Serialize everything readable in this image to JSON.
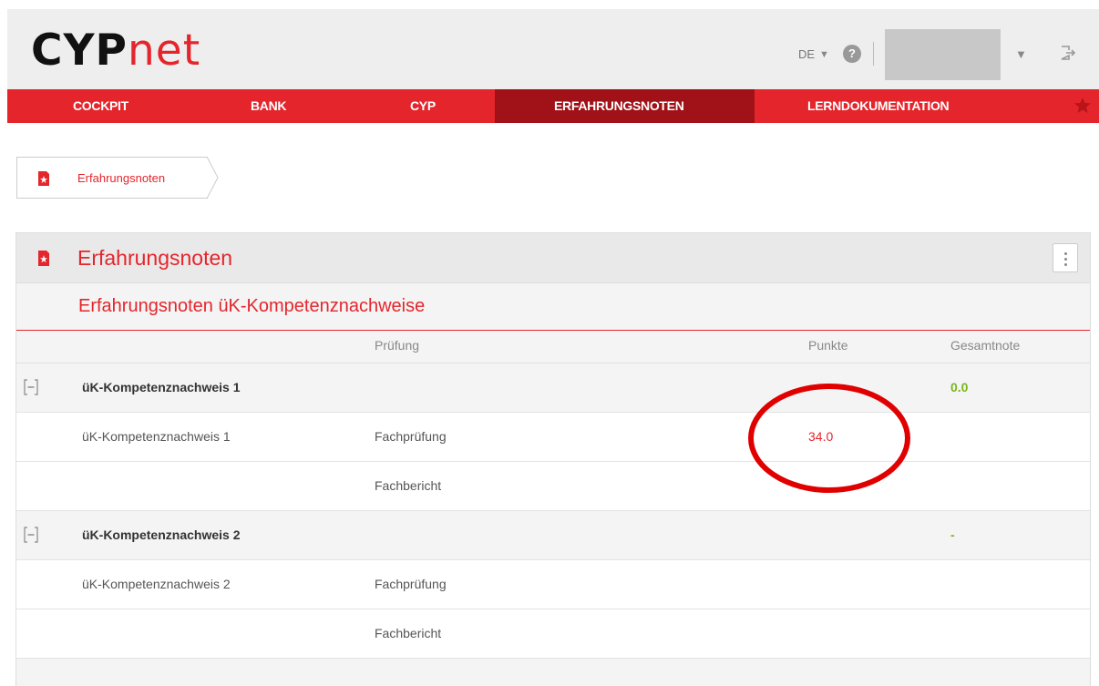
{
  "app": {
    "logo_part1": "CYP",
    "logo_part2": "net"
  },
  "topbar": {
    "language": "DE",
    "help_icon": "?"
  },
  "nav": {
    "items": [
      {
        "label": "COCKPIT"
      },
      {
        "label": "BANK"
      },
      {
        "label": "CYP"
      },
      {
        "label": "ERFAHRUNGSNOTEN",
        "active": true
      },
      {
        "label": "LERNDOKUMENTATION"
      }
    ]
  },
  "breadcrumb": {
    "label": "Erfahrungsnoten"
  },
  "panel": {
    "title": "Erfahrungsnoten",
    "subtitle": "Erfahrungsnoten üK-Kompetenznachweise",
    "columns": {
      "pruefung": "Prüfung",
      "punkte": "Punkte",
      "gesamtnote": "Gesamtnote"
    },
    "groups": [
      {
        "label": "üK-Kompetenznachweis 1",
        "gesamtnote": "0.0",
        "rows": [
          {
            "name": "üK-Kompetenznachweis 1",
            "pruefung": "Fachprüfung",
            "punkte": "34.0"
          },
          {
            "name": "",
            "pruefung": "Fachbericht",
            "punkte": ""
          }
        ]
      },
      {
        "label": "üK-Kompetenznachweis 2",
        "gesamtnote": "-",
        "rows": [
          {
            "name": "üK-Kompetenznachweis 2",
            "pruefung": "Fachprüfung",
            "punkte": ""
          },
          {
            "name": "",
            "pruefung": "Fachbericht",
            "punkte": ""
          }
        ]
      }
    ]
  },
  "colors": {
    "accent": "#e4262c",
    "nav_active": "#a01218",
    "grade_green": "#7ab51d"
  }
}
